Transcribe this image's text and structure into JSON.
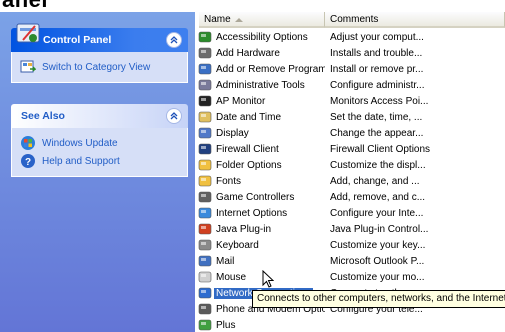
{
  "top_heading": "anel",
  "taskpane": {
    "control_panel": {
      "title": "Control Panel",
      "links": [
        {
          "label": "Switch to Category View",
          "icon": "switch-view-icon"
        }
      ]
    },
    "see_also": {
      "title": "See Also",
      "links": [
        {
          "label": "Windows Update",
          "icon": "windows-update-icon"
        },
        {
          "label": "Help and Support",
          "icon": "help-icon"
        }
      ]
    }
  },
  "list": {
    "columns": {
      "name": "Name",
      "comments": "Comments"
    },
    "sort_indicator": "ascending",
    "items": [
      {
        "name": "Accessibility Options",
        "comment": "Adjust your comput...",
        "icon": "accessibility-icon",
        "color": "#2b8c2b"
      },
      {
        "name": "Add Hardware",
        "comment": "Installs and trouble...",
        "icon": "hardware-icon",
        "color": "#6b6b6b"
      },
      {
        "name": "Add or Remove Programs",
        "comment": "Install or remove pr...",
        "icon": "programs-icon",
        "color": "#3a6fc4"
      },
      {
        "name": "Administrative Tools",
        "comment": "Configure administr...",
        "icon": "admin-tools-icon",
        "color": "#7a7a9a"
      },
      {
        "name": "AP Monitor",
        "comment": "Monitors Access Poi...",
        "icon": "monitor-icon",
        "color": "#222222"
      },
      {
        "name": "Date and Time",
        "comment": "Set the date, time, ...",
        "icon": "clock-icon",
        "color": "#e0c060"
      },
      {
        "name": "Display",
        "comment": "Change the appear...",
        "icon": "display-icon",
        "color": "#5078c8"
      },
      {
        "name": "Firewall Client",
        "comment": "Firewall Client Options",
        "icon": "firewall-icon",
        "color": "#204080"
      },
      {
        "name": "Folder Options",
        "comment": "Customize the displ...",
        "icon": "folder-icon",
        "color": "#f0c040"
      },
      {
        "name": "Fonts",
        "comment": "Add, change, and ...",
        "icon": "fonts-folder-icon",
        "color": "#f0c040"
      },
      {
        "name": "Game Controllers",
        "comment": "Add, remove, and c...",
        "icon": "game-controller-icon",
        "color": "#606060"
      },
      {
        "name": "Internet Options",
        "comment": "Configure your Inte...",
        "icon": "internet-icon",
        "color": "#3a8adc"
      },
      {
        "name": "Java Plug-in",
        "comment": "Java Plug-in Control...",
        "icon": "java-icon",
        "color": "#d04020"
      },
      {
        "name": "Keyboard",
        "comment": "Customize your key...",
        "icon": "keyboard-icon",
        "color": "#8a8a8a"
      },
      {
        "name": "Mail",
        "comment": "Microsoft Outlook P...",
        "icon": "mail-icon",
        "color": "#4070c0"
      },
      {
        "name": "Mouse",
        "comment": "Customize your mo...",
        "icon": "mouse-icon",
        "color": "#d0d0d0"
      },
      {
        "name": "Network Connections",
        "comment": "Connects to other c...",
        "icon": "network-icon",
        "color": "#2d6ccf",
        "selected": true
      },
      {
        "name": "Phone and Modem Options",
        "comment": "Configure your tele...",
        "icon": "phone-icon",
        "color": "#5a5a5a"
      },
      {
        "name": "Plus",
        "comment": "",
        "icon": "plus-icon",
        "color": "#40a040"
      }
    ]
  },
  "tooltip": "Connects to other computers, networks, and the Internet.",
  "colors": {
    "taskpane_top": "#7ba2e7",
    "taskpane_bottom": "#6375d6",
    "selection": "#316ac5",
    "link": "#215dc6"
  }
}
